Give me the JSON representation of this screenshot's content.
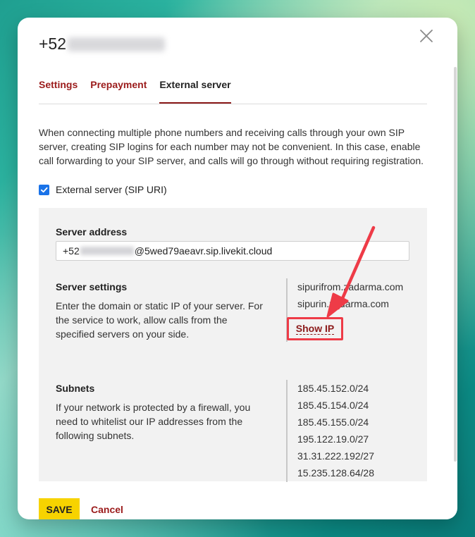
{
  "dialog": {
    "title_prefix": "+52",
    "close_icon": "close-icon"
  },
  "tabs": [
    {
      "label": "Settings"
    },
    {
      "label": "Prepayment"
    },
    {
      "label": "External server"
    }
  ],
  "description": "When connecting multiple phone numbers and receiving calls through your own SIP server, creating SIP logins for each number may not be convenient. In this case, enable call forwarding to your SIP server, and calls will go through without requiring registration.",
  "external_server": {
    "checkbox_label": "External server (SIP URI)",
    "checked": true
  },
  "server_address": {
    "label": "Server address",
    "value_prefix": "+52",
    "value_suffix": "@5wed79aeavr.sip.livekit.cloud"
  },
  "server_settings": {
    "label": "Server settings",
    "description": "Enter the domain or static IP of your server. For the service to work, allow calls from the specified servers on your side.",
    "servers": [
      "sipurifrom.zadarma.com",
      "sipurin.zadarma.com"
    ],
    "show_ip_label": "Show IP"
  },
  "subnets": {
    "label": "Subnets",
    "description": "If your network is protected by a firewall, you need to whitelist our IP addresses from the following subnets.",
    "items": [
      "185.45.152.0/24",
      "185.45.154.0/24",
      "185.45.155.0/24",
      "195.122.19.0/27",
      "31.31.222.192/27",
      "15.235.128.64/28"
    ]
  },
  "footer": {
    "save_label": "SAVE",
    "cancel_label": "Cancel"
  },
  "colors": {
    "accent_red": "#9b1b1b",
    "save_yellow": "#f7d300",
    "checkbox_blue": "#1a73e8",
    "highlight_red": "#ee3b47"
  }
}
